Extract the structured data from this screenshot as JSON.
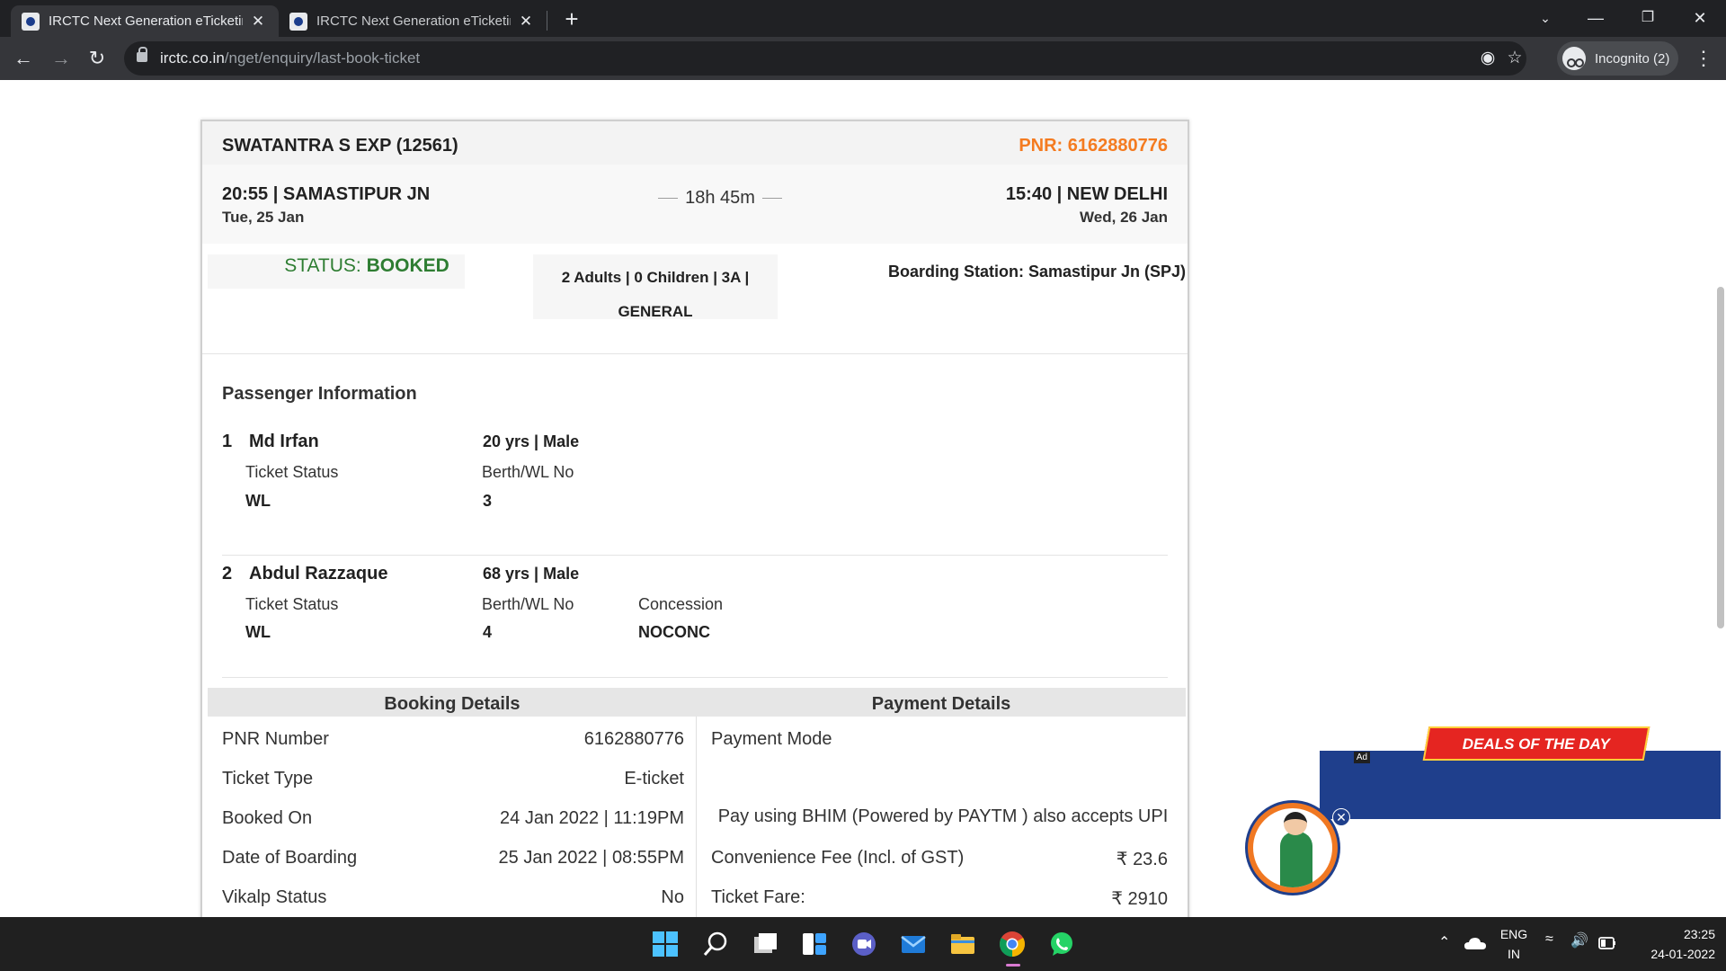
{
  "browser": {
    "tabs": [
      {
        "title": "IRCTC Next Generation eTicketing"
      },
      {
        "title": "IRCTC Next Generation eTicketing"
      }
    ],
    "url_host": "irctc.co.in",
    "url_path": "/nget/enquiry/last-book-ticket",
    "profile_label": "Incognito (2)"
  },
  "ticket": {
    "train": "SWATANTRA S EXP (12561)",
    "pnr_header": "PNR: 6162880776",
    "departure": {
      "time_station": "20:55 | SAMASTIPUR JN",
      "date": "Tue, 25 Jan"
    },
    "duration": "18h 45m",
    "arrival": {
      "time_station": "15:40 | NEW DELHI",
      "date": "Wed, 26 Jan"
    },
    "status_label": "STATUS: ",
    "status_value": "BOOKED",
    "class_line1": "2 Adults | 0 Children | 3A |",
    "class_line2": "GENERAL",
    "boarding": "Boarding Station: Samastipur Jn (SPJ)"
  },
  "passengers": {
    "title": "Passenger Information",
    "list": [
      {
        "num": "1",
        "name": "Md Irfan",
        "age_gender": "20 yrs | Male",
        "status_label": "Ticket Status",
        "status": "WL",
        "berth_label": "Berth/WL No",
        "berth": "3"
      },
      {
        "num": "2",
        "name": "Abdul Razzaque",
        "age_gender": "68 yrs | Male",
        "status_label": "Ticket Status",
        "status": "WL",
        "berth_label": "Berth/WL No",
        "berth": "4",
        "concession_label": "Concession",
        "concession": "NOCONC"
      }
    ]
  },
  "booking": {
    "title": "Booking Details",
    "rows": [
      {
        "label": "PNR Number",
        "value": "6162880776"
      },
      {
        "label": "Ticket Type",
        "value": "E-ticket"
      },
      {
        "label": "Booked On",
        "value": "24 Jan 2022 | 11:19PM"
      },
      {
        "label": "Date of Boarding",
        "value": "25 Jan 2022 | 08:55PM"
      },
      {
        "label": "Vikalp Status",
        "value": "No"
      }
    ]
  },
  "payment": {
    "title": "Payment Details",
    "mode_label": "Payment Mode",
    "mode_desc": "Pay using BHIM (Powered by PAYTM ) also accepts UPI",
    "fee_label": "Convenience Fee (Incl. of GST)",
    "fee_value": "₹ 23.6",
    "fare_label": "Ticket Fare:",
    "fare_value": "₹ 2910"
  },
  "ad": {
    "headline": "DEALS OF THE DAY",
    "tag": "Ad"
  },
  "taskbar": {
    "lang_line1": "ENG",
    "lang_line2": "IN",
    "time": "23:25",
    "date": "24-01-2022"
  },
  "colors": {
    "pnr_orange": "#f47b20",
    "status_green": "#2e7d32",
    "chrome_dark": "#202124"
  }
}
